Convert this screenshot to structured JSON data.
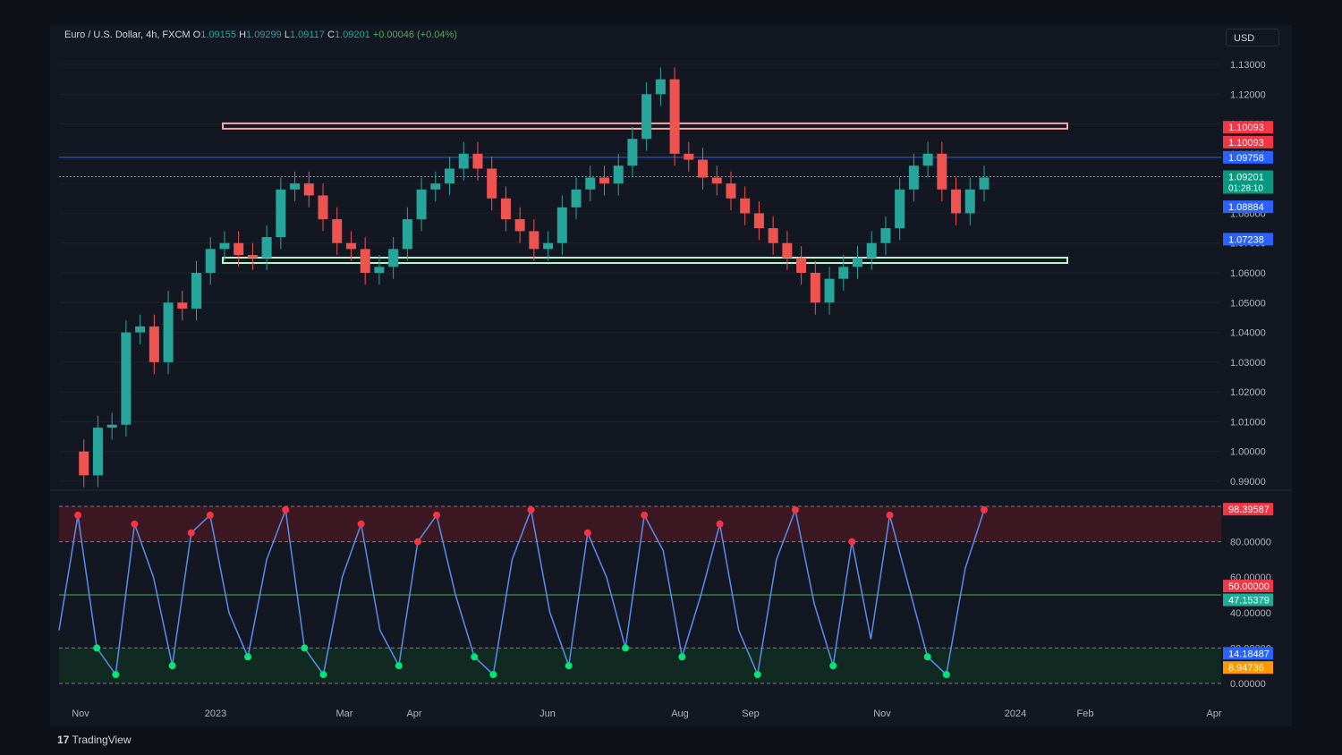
{
  "header": {
    "symbol": "Euro / U.S. Dollar, 4h, FXCM",
    "o_label": "O",
    "o_value": "1.09155",
    "h_label": "H",
    "h_value": "1.09299",
    "l_label": "L",
    "l_value": "1.09117",
    "c_label": "C",
    "c_value": "1.09201",
    "change": "+0.00046 (+0.04%)"
  },
  "currency": "USD",
  "brand": "TradingView",
  "colors": {
    "bg": "#131722",
    "up": "#26a69a",
    "down": "#ef5350",
    "text": "#d1d4dc"
  },
  "chart_data": [
    {
      "type": "candlestick",
      "pane": "price",
      "ylim": [
        0.99,
        1.13
      ],
      "y_ticks": [
        "1.13000",
        "1.12000",
        "1.11000",
        "1.10000",
        "1.09000",
        "1.08000",
        "1.07000",
        "1.06000",
        "1.05000",
        "1.04000",
        "1.03000",
        "1.02000",
        "1.01000",
        "1.00000",
        "0.99000"
      ],
      "price_labels": [
        {
          "text": "1.10093",
          "value": 1.1089,
          "color": "#f23645"
        },
        {
          "text": "1.10093",
          "value": 1.1039,
          "color": "#f23645"
        },
        {
          "text": "1.09758",
          "value": 1.0988,
          "color": "#2962ff"
        },
        {
          "text": "1.09201",
          "value": 1.0923,
          "color": "#089981",
          "sub": "01:28:10"
        },
        {
          "text": "1.08884",
          "value": 1.0822,
          "color": "#2962ff"
        },
        {
          "text": "1.07238",
          "value": 1.0713,
          "color": "#2962ff"
        }
      ],
      "zones": [
        {
          "name": "resistance",
          "value": 1.1093,
          "color": "#f7a5a5"
        },
        {
          "name": "support",
          "value": 1.0642,
          "color": "#b9f6ca"
        }
      ],
      "series": [
        {
          "name": "close",
          "values": [
            1.0,
            0.992,
            1.008,
            1.009,
            1.04,
            1.042,
            1.03,
            1.05,
            1.048,
            1.06,
            1.068,
            1.07,
            1.066,
            1.065,
            1.072,
            1.088,
            1.09,
            1.086,
            1.078,
            1.07,
            1.068,
            1.06,
            1.062,
            1.068,
            1.078,
            1.088,
            1.09,
            1.095,
            1.1,
            1.095,
            1.085,
            1.078,
            1.074,
            1.068,
            1.07,
            1.082,
            1.088,
            1.092,
            1.09,
            1.096,
            1.105,
            1.12,
            1.125,
            1.1,
            1.098,
            1.092,
            1.09,
            1.085,
            1.08,
            1.075,
            1.07,
            1.065,
            1.06,
            1.05,
            1.058,
            1.062,
            1.065,
            1.07,
            1.075,
            1.088,
            1.096,
            1.1,
            1.088,
            1.08,
            1.088,
            1.092
          ]
        }
      ]
    },
    {
      "type": "line",
      "pane": "oscillator",
      "ylim": [
        0,
        100
      ],
      "y_ticks": [
        "80.00000",
        "60.00000",
        "40.00000",
        "20.00000",
        "0.00000"
      ],
      "levels": [
        80,
        50,
        20
      ],
      "value_labels": [
        {
          "text": "98.39587",
          "value": 98.4,
          "color": "#f23645"
        },
        {
          "text": "50.00000",
          "value": 55.0,
          "color": "#f23645"
        },
        {
          "text": "47.15379",
          "value": 47.2,
          "color": "#22ab94"
        },
        {
          "text": "14.18487",
          "value": 17.0,
          "color": "#2962ff"
        },
        {
          "text": "8.94736",
          "value": 9.0,
          "color": "#ff9800"
        }
      ],
      "series": [
        {
          "name": "",
          "values": [
            30,
            95,
            20,
            5,
            90,
            60,
            10,
            85,
            95,
            40,
            15,
            70,
            98,
            20,
            5,
            60,
            90,
            30,
            10,
            80,
            95,
            50,
            15,
            5,
            70,
            98,
            40,
            10,
            85,
            60,
            20,
            95,
            75,
            15,
            50,
            90,
            30,
            5,
            70,
            98,
            45,
            10,
            80,
            25,
            95,
            55,
            15,
            5,
            65,
            98
          ]
        }
      ]
    }
  ],
  "x_ticks": [
    "Nov",
    "2023",
    "Mar",
    "Apr",
    "Jun",
    "Aug",
    "Sep",
    "Nov",
    "2024",
    "Feb",
    "Apr"
  ]
}
